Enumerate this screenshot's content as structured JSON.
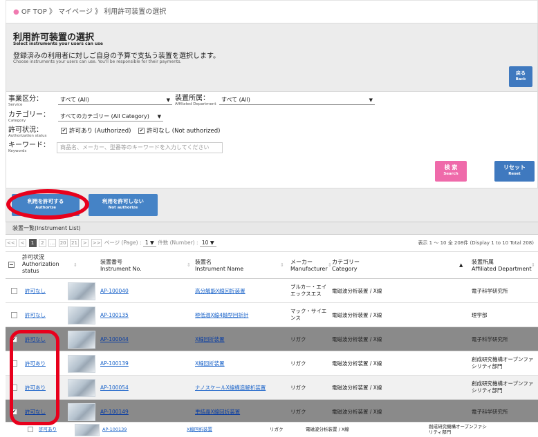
{
  "breadcrumb": {
    "bullet": "●",
    "items": [
      "OF TOP",
      "マイページ",
      "利用許可装置の選択"
    ],
    "sep": "》"
  },
  "header": {
    "title": "利用許可装置の選択",
    "subtitle_en": "Select instruments your users can use",
    "desc_ja": "登録済みの利用者に対しご自身の予算で支払う装置を選択します。",
    "desc_en": "Choose instruments your users can use. You'll be responsible for their payments.",
    "back_ja": "戻る",
    "back_en": "Back"
  },
  "filters": {
    "service_label": "事業区分：",
    "service_label_en": "Service",
    "service_value": "すべて (All)",
    "dept_label": "装置所属：",
    "dept_label_en": "Affiliated Department",
    "dept_value": "すべて (All)",
    "category_label": "カテゴリー：",
    "category_label_en": "Category",
    "category_value": "すべてのカテゴリー (All Category)",
    "auth_label": "許可状況：",
    "auth_label_en": "Authorization status",
    "auth_opt1": "許可あり (Authorized)",
    "auth_opt2": "許可なし (Not authorized)",
    "kw_label": "キーワード：",
    "kw_label_en": "Keywords",
    "kw_placeholder": "商品名、メーカー、型番等のキーワードを入力してください",
    "search_ja": "検 索",
    "search_en": "Search",
    "reset_ja": "リセット",
    "reset_en": "Reset",
    "check": "✔",
    "arrow": "▼"
  },
  "actions": {
    "authorize_ja": "利用を許可する",
    "authorize_en": "Authorize",
    "notauth_ja": "利用を許可しない",
    "notauth_en": "Not authorize"
  },
  "list": {
    "title": "装置一覧(Instrument List)"
  },
  "pager": {
    "first": "<<",
    "prev": "<",
    "p1": "1",
    "p2": "2",
    "dots": "...",
    "p20": "20",
    "p21": "21",
    "next": ">",
    "last": ">>",
    "page_label": "ページ (Page) :",
    "page_value": "1",
    "num_label": "件数 (Number) :",
    "num_value": "10",
    "display": "表示 1 〜 10 全 208件 (Display 1 to 10 Total 208)"
  },
  "columns": {
    "status_ja": "許可状況",
    "status_en": "Authorization status",
    "no_ja": "装置番号",
    "no_en": "Instrument No.",
    "name_ja": "装置名",
    "name_en": "Instrument Name",
    "maker_ja": "メーカー",
    "maker_en": "Manufacturer",
    "cat_ja": "カテゴリー",
    "cat_en": "Category",
    "dept_ja": "装置所属",
    "dept_en": "Affiliated Department",
    "sort_both": "⇕",
    "sort_up": "▲"
  },
  "rows": [
    {
      "status": "許可なし",
      "no": "AP-100040",
      "name": "高分解能X線回折装置",
      "maker": "ブルカー・エイエックスエス",
      "cat": "電磁波分析装置 / X線",
      "dept": "電子科学研究所",
      "checked": false
    },
    {
      "status": "許可なし",
      "no": "AP-100135",
      "name": "極低温X線4軸型回折計",
      "maker": "マック・サイエンス",
      "cat": "電磁波分析装置 / X線",
      "dept": "理学部",
      "checked": false
    },
    {
      "status": "許可なし",
      "no": "AP-100044",
      "name": "X線回折装置",
      "maker": "リガク",
      "cat": "電磁波分析装置 / X線",
      "dept": "電子科学研究所",
      "checked": true
    },
    {
      "status": "許可あり",
      "no": "AP-100139",
      "name": "X線回折装置",
      "maker": "リガク",
      "cat": "電磁波分析装置 / X線",
      "dept": "創成研究機構オープンファシリティ部門",
      "checked": false
    },
    {
      "status": "許可あり",
      "no": "AP-100054",
      "name": "ナノスケールX線構造解析装置",
      "maker": "リガク",
      "cat": "電磁波分析装置 / X線",
      "dept": "創成研究機構オープンファシリティ部門",
      "checked": false
    },
    {
      "status": "許可なし",
      "no": "AP-100149",
      "name": "単結晶X線回折装置",
      "maker": "リガク",
      "cat": "電磁波分析装置 / X線",
      "dept": "電子科学研究所",
      "checked": true
    }
  ],
  "ghost": {
    "status": "許可あり",
    "no": "AP-100139",
    "name": "X線回折装置",
    "maker": "リガク",
    "cat": "電磁波分析装置 / X線",
    "dept": "創成研究機構オープンファシリティ部門"
  }
}
